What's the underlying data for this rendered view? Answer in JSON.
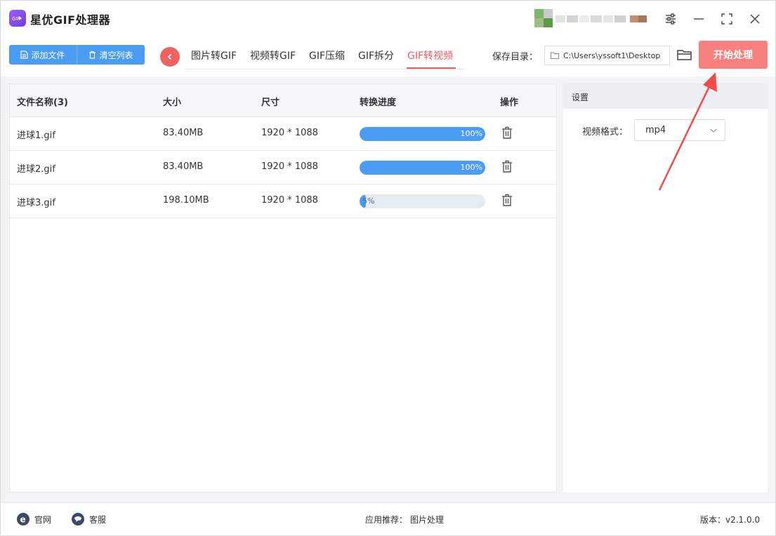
{
  "app": {
    "title": "星优GIF处理器"
  },
  "toolbar": {
    "add_file": "添加文件",
    "clear_list": "清空列表",
    "tabs": [
      "图片转GIF",
      "视频转GIF",
      "GIF压缩",
      "GIF拆分",
      "GIF转视频"
    ],
    "active_tab": "GIF转视频",
    "save_label": "保存目录：",
    "save_path": "C:\\Users\\yssoft1\\Desktop",
    "start_button": "开始处理"
  },
  "table": {
    "headers": [
      "文件名称(3)",
      "大小",
      "尺寸",
      "转换进度",
      "操作"
    ],
    "rows": [
      {
        "name": "进球1.gif",
        "size": "83.40MB",
        "dims": "1920 * 1088",
        "progress": 100,
        "progress_label": "100%"
      },
      {
        "name": "进球2.gif",
        "size": "83.40MB",
        "dims": "1920 * 1088",
        "progress": 100,
        "progress_label": "100%"
      },
      {
        "name": "进球3.gif",
        "size": "198.10MB",
        "dims": "1920 * 1088",
        "progress": 5,
        "progress_label": "5%"
      }
    ]
  },
  "settings": {
    "title": "设置",
    "format_label": "视频格式：",
    "format_value": "mp4"
  },
  "footer": {
    "website": "官网",
    "support": "客服",
    "recommend_label": "应用推荐：",
    "recommend_value": "图片处理",
    "version": "版本：v2.1.0.0"
  },
  "colors": {
    "accent_blue": "#4a9df2",
    "accent_red": "#ef5a5a",
    "start_button": "#f7817f"
  }
}
